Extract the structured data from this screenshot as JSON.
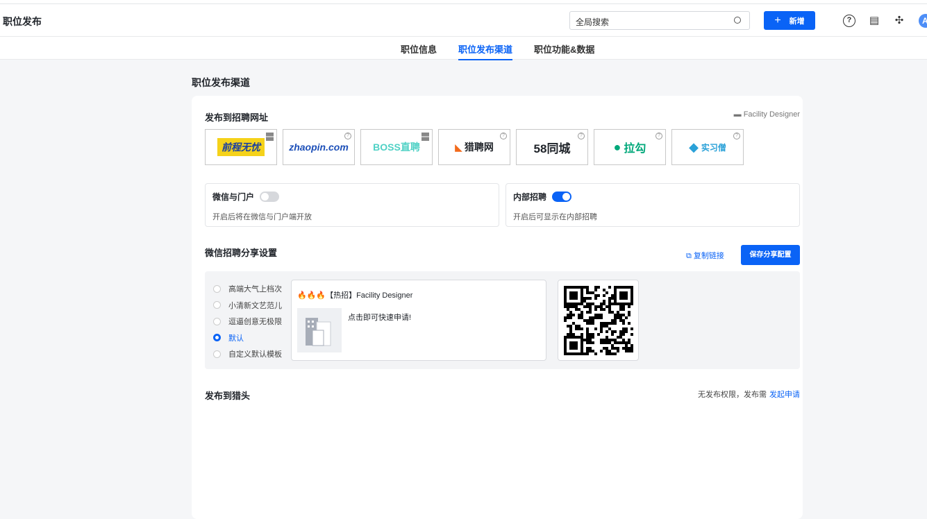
{
  "header": {
    "title": "职位发布",
    "search_placeholder": "全局搜索",
    "new_label": "新增",
    "avatar": "A"
  },
  "tabs": [
    {
      "label": "职位信息"
    },
    {
      "label": "职位发布渠道"
    },
    {
      "label": "职位功能&数据"
    }
  ],
  "section_title": "职位发布渠道",
  "sites": {
    "title": "发布到招聘网址",
    "job_name": "Facility Designer",
    "logos": [
      {
        "name": "前程无忧",
        "color": "#1a3fa0"
      },
      {
        "name": "zhaopin.com",
        "color": "#1c4fb8"
      },
      {
        "name": "BOSS直聘",
        "color": "#4fd1c5"
      },
      {
        "name": "猎聘网",
        "color": "#333333"
      },
      {
        "name": "58同城",
        "color": "#333333"
      },
      {
        "name": "拉勾",
        "color": "#00a87a"
      },
      {
        "name": "实习僧",
        "color": "#2aa1d8"
      }
    ]
  },
  "wechat": {
    "title": "微信与门户",
    "desc": "开启后将在微信与门户端开放",
    "enabled": false
  },
  "internal": {
    "title": "内部招聘",
    "desc": "开启后可显示在内部招聘",
    "enabled": true
  },
  "share": {
    "title": "微信招聘分享设置",
    "copy_label": "复制链接",
    "save_label": "保存分享配置",
    "templates": [
      "高端大气上档次",
      "小清新文艺范儿",
      "逗逼创意无极限",
      "默认",
      "自定义默认模板"
    ],
    "selected": 3,
    "preview_title": "🔥🔥🔥【热招】Facility Designer",
    "preview_desc": "点击即可快速申请!"
  },
  "headhunter": {
    "title": "发布到猎头",
    "notice": "无发布权限，发布需",
    "apply_label": "发起申请"
  }
}
